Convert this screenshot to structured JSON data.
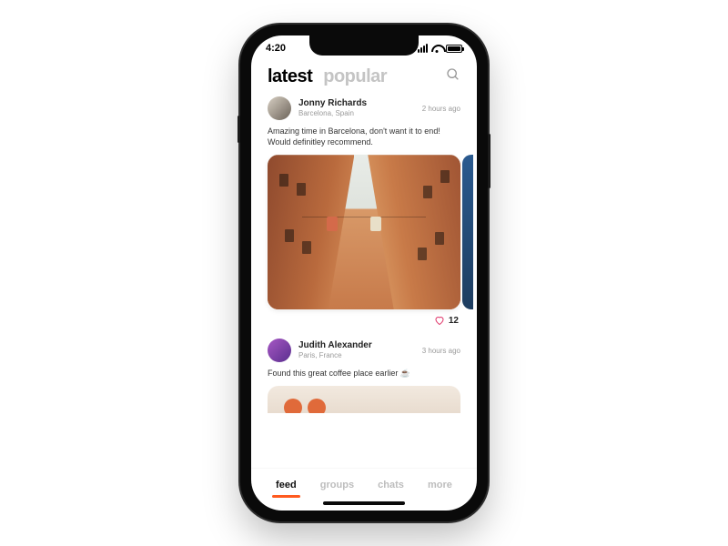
{
  "status": {
    "time": "4:20"
  },
  "header": {
    "tabs": {
      "active": "latest",
      "inactive": "popular"
    }
  },
  "posts": [
    {
      "user": "Jonny Richards",
      "location": "Barcelona, Spain",
      "time": "2 hours ago",
      "caption": "Amazing time in Barcelona, don't want it to end! Would definitley recommend.",
      "likes": "12"
    },
    {
      "user": "Judith Alexander",
      "location": "Paris, France",
      "time": "3 hours ago",
      "caption": "Found this great coffee place earlier ☕"
    }
  ],
  "nav": {
    "feed": "feed",
    "groups": "groups",
    "chats": "chats",
    "more": "more"
  }
}
